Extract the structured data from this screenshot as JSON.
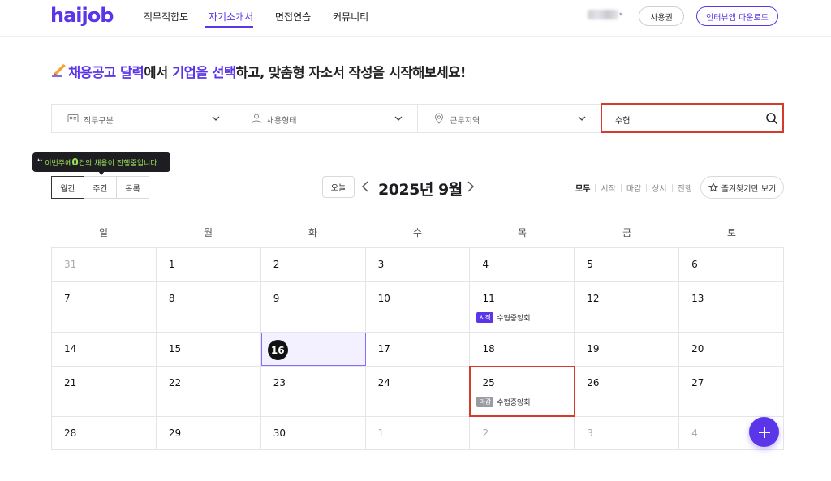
{
  "header": {
    "logo_main": "haijob",
    "nav": [
      "직무적합도",
      "자기소개서",
      "면접연습",
      "커뮤니티"
    ],
    "active_nav": "자기소개서",
    "coupon_label": "사용권",
    "download_label": "인터뷰앱 다운로드"
  },
  "headline": {
    "accent1": "채용공고 달력",
    "text1": "에서 ",
    "accent2": "기업을 선택",
    "text2": "하고, 맞춤형 자소서 작성을 시작해보세요!"
  },
  "filters": {
    "job_category": "직무구분",
    "employment_type": "채용형태",
    "work_region": "근무지역",
    "search_value": "수협"
  },
  "tooltip": {
    "prefix": "이번주에 ",
    "count": "0",
    "suffix": "건의 채용이 진행중입니다."
  },
  "view_tabs": [
    "월간",
    "주간",
    "목록"
  ],
  "active_view": "월간",
  "calendar": {
    "today_label": "오늘",
    "title": "2025년 9월",
    "status_filters": [
      "모두",
      "시작",
      "마감",
      "상시",
      "진행"
    ],
    "active_status": "모두",
    "favorites_label": "즐겨찾기만 보기",
    "weekdays": [
      "일",
      "월",
      "화",
      "수",
      "목",
      "금",
      "토"
    ],
    "today_date": "16",
    "weeks": [
      [
        {
          "d": "31",
          "other": true
        },
        {
          "d": "1"
        },
        {
          "d": "2"
        },
        {
          "d": "3"
        },
        {
          "d": "4"
        },
        {
          "d": "5"
        },
        {
          "d": "6"
        }
      ],
      [
        {
          "d": "7"
        },
        {
          "d": "8"
        },
        {
          "d": "9"
        },
        {
          "d": "10"
        },
        {
          "d": "11",
          "events": [
            {
              "badge": "시작",
              "type": "start",
              "name": "수협중앙회"
            }
          ]
        },
        {
          "d": "12"
        },
        {
          "d": "13"
        }
      ],
      [
        {
          "d": "14"
        },
        {
          "d": "15"
        },
        {
          "d": "16",
          "today": true
        },
        {
          "d": "17"
        },
        {
          "d": "18"
        },
        {
          "d": "19"
        },
        {
          "d": "20"
        }
      ],
      [
        {
          "d": "21"
        },
        {
          "d": "22"
        },
        {
          "d": "23"
        },
        {
          "d": "24"
        },
        {
          "d": "25",
          "highlight": true,
          "events": [
            {
              "badge": "마감",
              "type": "end",
              "name": "수협중앙회"
            }
          ]
        },
        {
          "d": "26"
        },
        {
          "d": "27"
        }
      ],
      [
        {
          "d": "28"
        },
        {
          "d": "29"
        },
        {
          "d": "30"
        },
        {
          "d": "1",
          "other": true
        },
        {
          "d": "2",
          "other": true
        },
        {
          "d": "3",
          "other": true
        },
        {
          "d": "4",
          "other": true
        }
      ]
    ]
  },
  "colors": {
    "brand": "#5b35e8",
    "highlight": "#d63a2a",
    "start_badge": "#5b35e8",
    "end_badge": "#9a9aa3"
  }
}
